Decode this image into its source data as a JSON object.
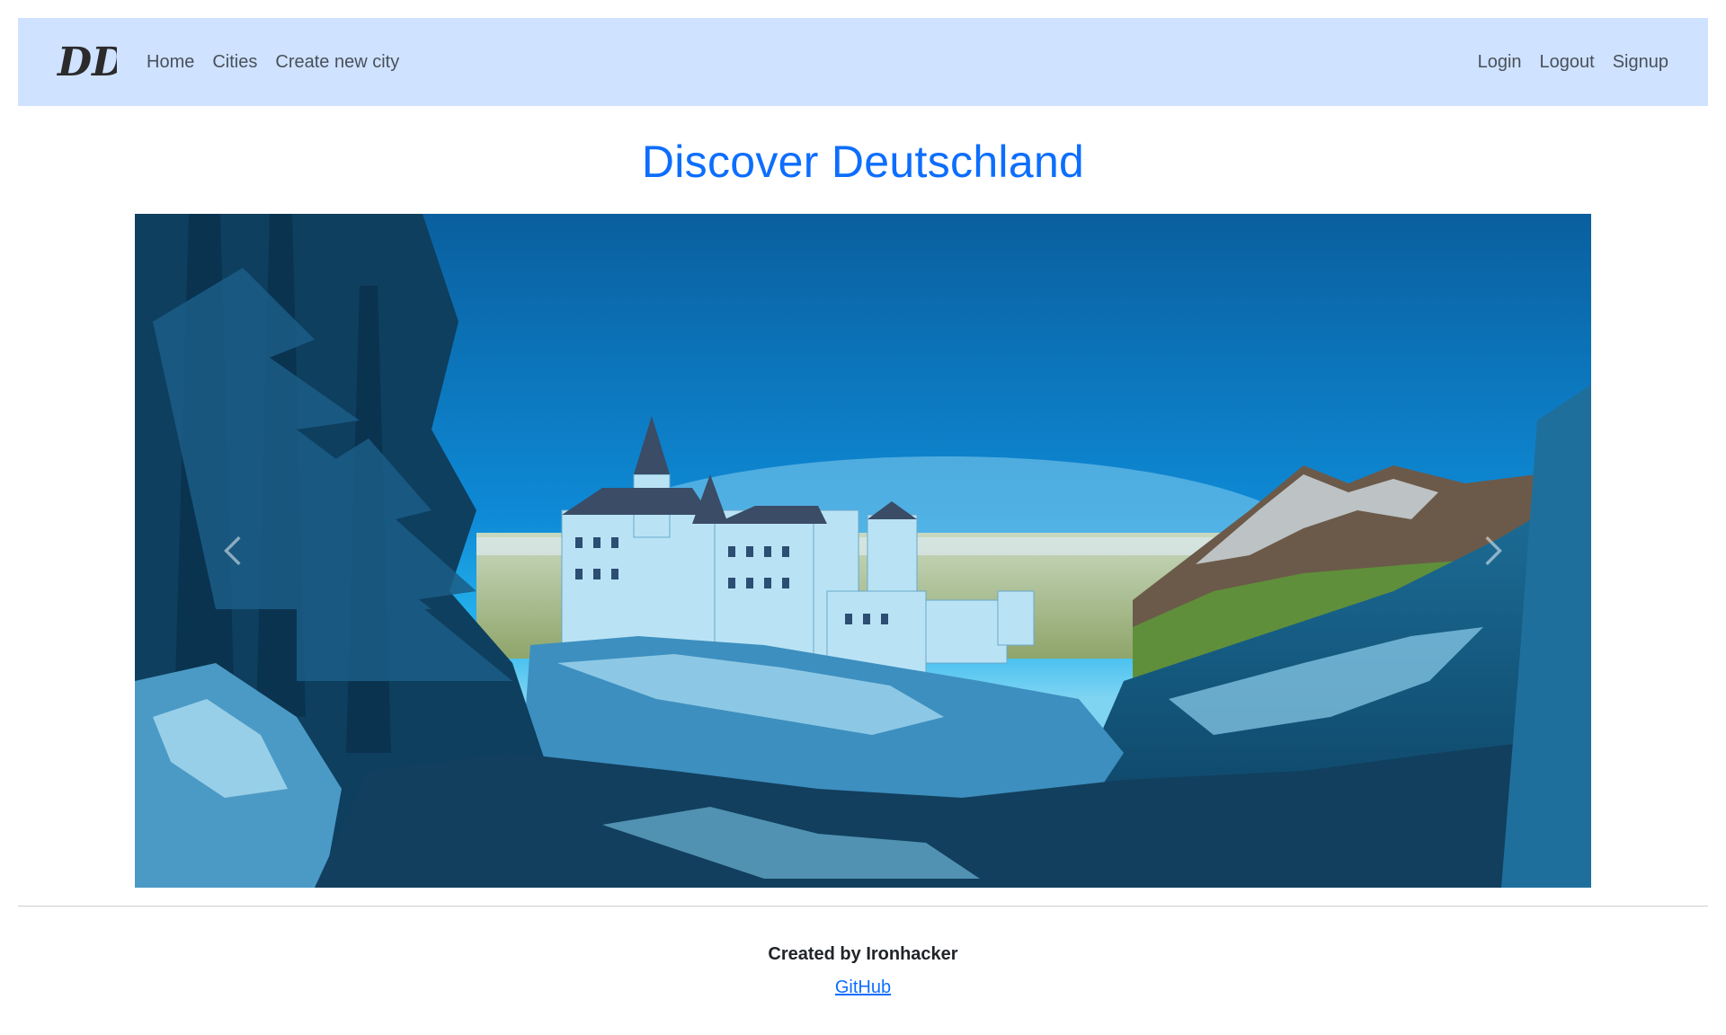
{
  "nav": {
    "brand": "DD",
    "left_links": [
      {
        "label": "Home"
      },
      {
        "label": "Cities"
      },
      {
        "label": "Create new city"
      }
    ],
    "right_links": [
      {
        "label": "Login"
      },
      {
        "label": "Logout"
      },
      {
        "label": "Signup"
      }
    ]
  },
  "hero": {
    "title": "Discover Deutschland"
  },
  "carousel": {
    "prev_icon": "chevron-left-icon",
    "next_icon": "chevron-right-icon"
  },
  "footer": {
    "credit": "Created by Ironhacker",
    "link_label": "GitHub"
  },
  "colors": {
    "navbar_bg": "#cfe2ff",
    "accent": "#0d6efd",
    "text": "#212529"
  }
}
